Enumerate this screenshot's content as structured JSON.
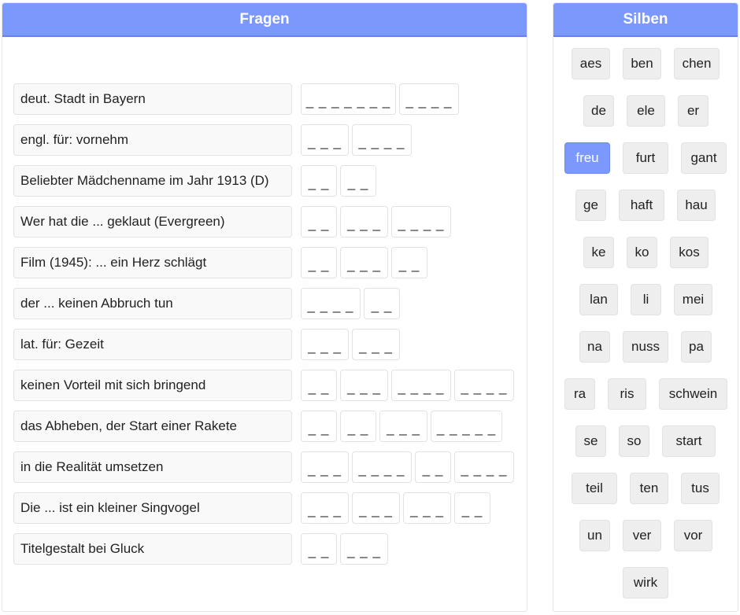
{
  "questions_panel": {
    "title": "Fragen"
  },
  "syllables_panel": {
    "title": "Silben"
  },
  "questions": [
    {
      "label": "deut. Stadt in Bayern",
      "slots": [
        "_ _ _ _ _ _ _",
        "_ _ _ _"
      ]
    },
    {
      "label": "engl. für: vornehm",
      "slots": [
        "_ _ _",
        "_ _ _ _"
      ]
    },
    {
      "label": "Beliebter Mädchenname im Jahr 1913 (D)",
      "slots": [
        "_ _",
        "_ _"
      ]
    },
    {
      "label": "Wer hat die ... geklaut (Evergreen)",
      "slots": [
        "_ _",
        "_ _ _",
        "_ _ _ _"
      ]
    },
    {
      "label": "Film (1945): ... ein Herz schlägt",
      "slots": [
        "_ _",
        "_ _ _",
        "_ _"
      ]
    },
    {
      "label": "der ... keinen Abbruch tun",
      "slots": [
        "_ _ _ _",
        "_ _"
      ]
    },
    {
      "label": "lat. für: Gezeit",
      "slots": [
        "_ _ _",
        "_ _ _"
      ]
    },
    {
      "label": "keinen Vorteil mit sich bringend",
      "slots": [
        "_ _",
        "_ _ _",
        "_ _ _ _",
        "_ _ _ _"
      ]
    },
    {
      "label": "das Abheben, der Start einer Rakete",
      "slots": [
        "_ _",
        "_ _",
        "_ _ _",
        "_ _ _ _ _"
      ]
    },
    {
      "label": "in die Realität umsetzen",
      "slots": [
        "_ _ _",
        "_ _ _ _",
        "_ _",
        "_ _ _ _"
      ]
    },
    {
      "label": "Die ... ist ein kleiner Singvogel",
      "slots": [
        "_ _ _",
        "_ _ _",
        "_ _ _",
        "_ _"
      ]
    },
    {
      "label": "Titelgestalt bei Gluck",
      "slots": [
        "_ _",
        "_ _ _"
      ]
    }
  ],
  "syllables": [
    [
      "aes",
      "ben",
      "chen"
    ],
    [
      "de",
      "ele",
      "er"
    ],
    [
      "freu",
      "furt",
      "gant"
    ],
    [
      "ge",
      "haft",
      "hau"
    ],
    [
      "ke",
      "ko",
      "kos"
    ],
    [
      "lan",
      "li",
      "mei"
    ],
    [
      "na",
      "nuss",
      "pa"
    ],
    [
      "ra",
      "ris",
      "schwein"
    ],
    [
      "se",
      "so",
      "start"
    ],
    [
      "teil",
      "ten",
      "tus"
    ],
    [
      "un",
      "ver",
      "vor"
    ],
    [
      "wirk"
    ]
  ],
  "selected_syllable": "freu",
  "colors": {
    "accent": "#7b98fc",
    "chip": "#eeeeee",
    "border": "#e2e2e2"
  }
}
